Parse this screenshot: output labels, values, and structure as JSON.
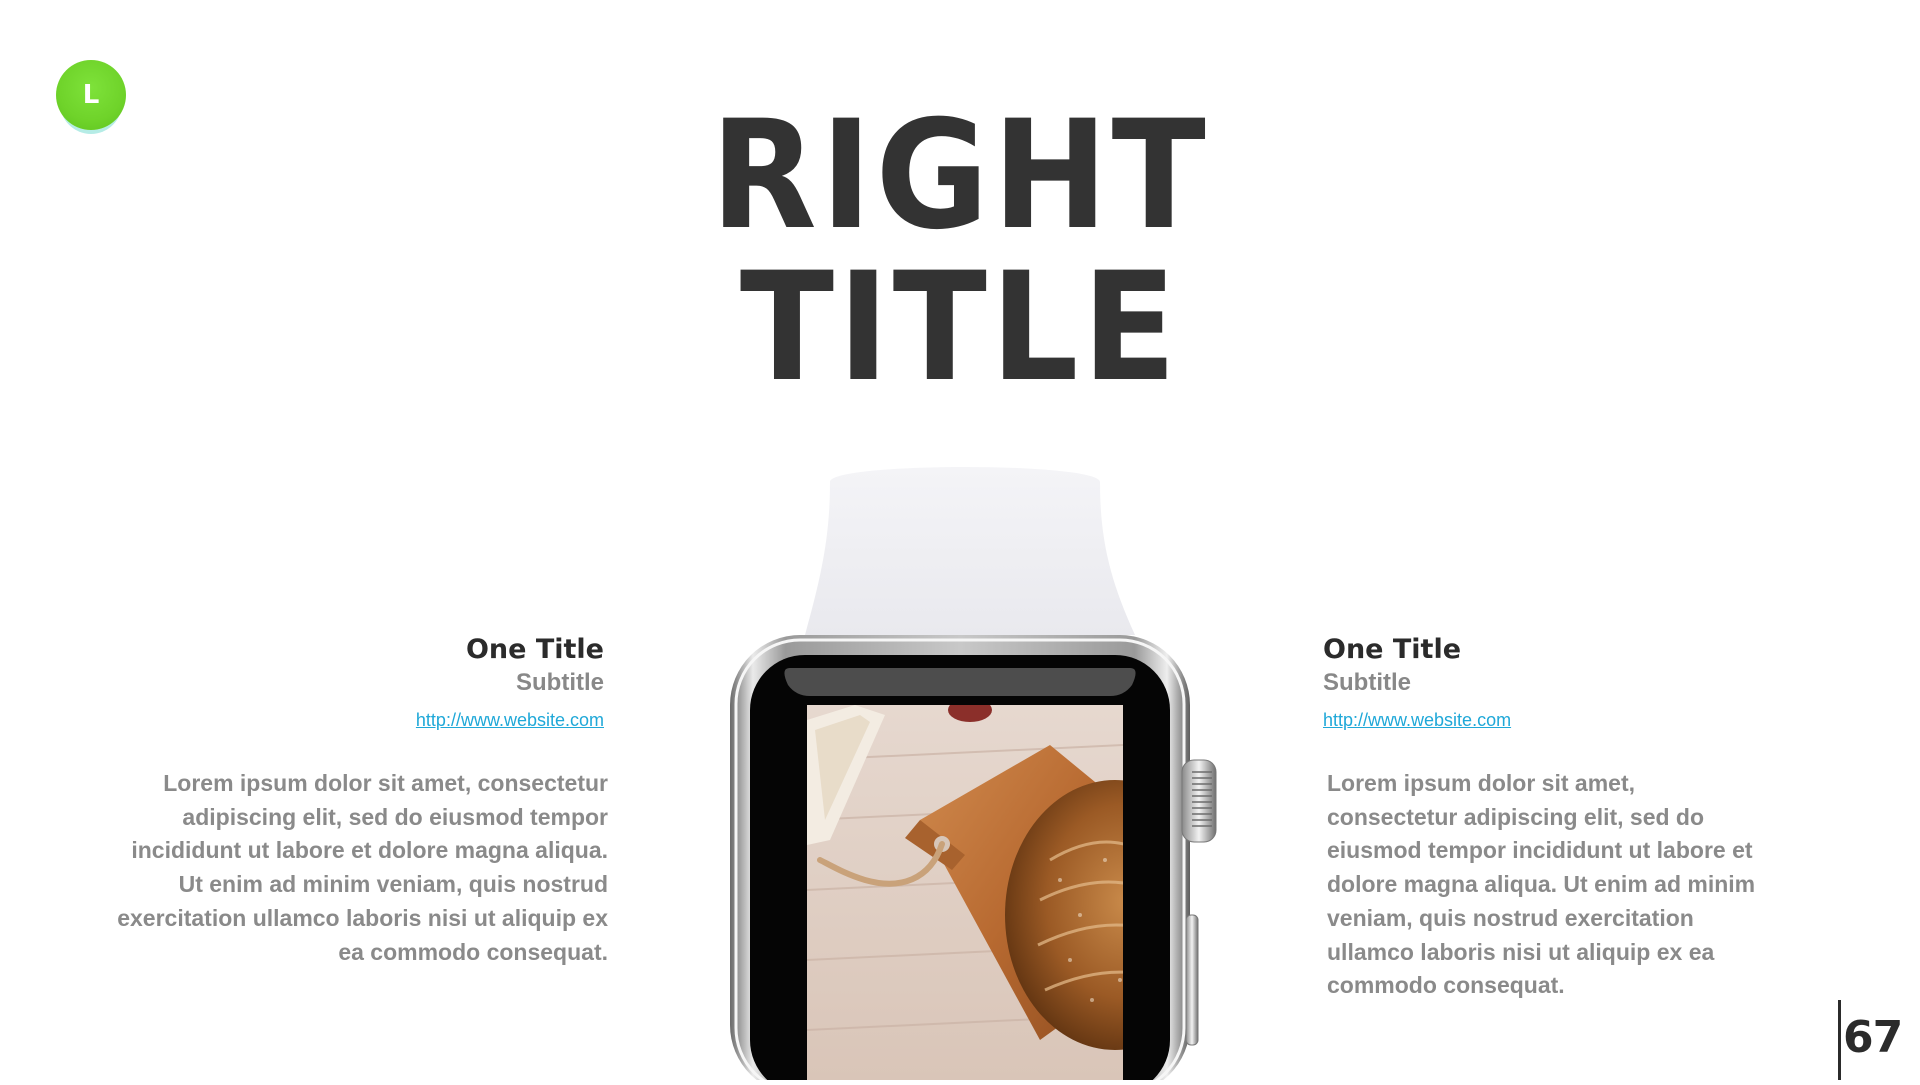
{
  "logo": {
    "letter": "L",
    "color": "#6fd32a"
  },
  "title": {
    "line1": "RIGHT",
    "line2": "TITLE"
  },
  "left_block": {
    "title": "One Title",
    "subtitle": "Subtitle",
    "link": "http://www.website.com",
    "body": "Lorem ipsum dolor sit amet, consectetur adipiscing elit, sed do eiusmod tempor incididunt ut labore et dolore magna aliqua. Ut enim ad minim veniam, quis nostrud exercitation ullamco laboris nisi ut aliquip ex ea commodo consequat."
  },
  "right_block": {
    "title": "One Title",
    "subtitle": "Subtitle",
    "link": "http://www.website.com",
    "body": "Lorem ipsum dolor sit amet, consectetur adipiscing elit, sed do eiusmod tempor incididunt ut labore et dolore magna aliqua. Ut enim ad minim veniam, quis nostrud exercitation ullamco laboris nisi ut aliquip ex ea commodo consequat."
  },
  "watch": {
    "screen_image": "bread-on-cutting-board-image",
    "strap_color": "#f1f1f4"
  },
  "page_number": "67",
  "colors": {
    "title": "#333333",
    "body": "#8a8a8a",
    "link": "#1fa8d8"
  }
}
